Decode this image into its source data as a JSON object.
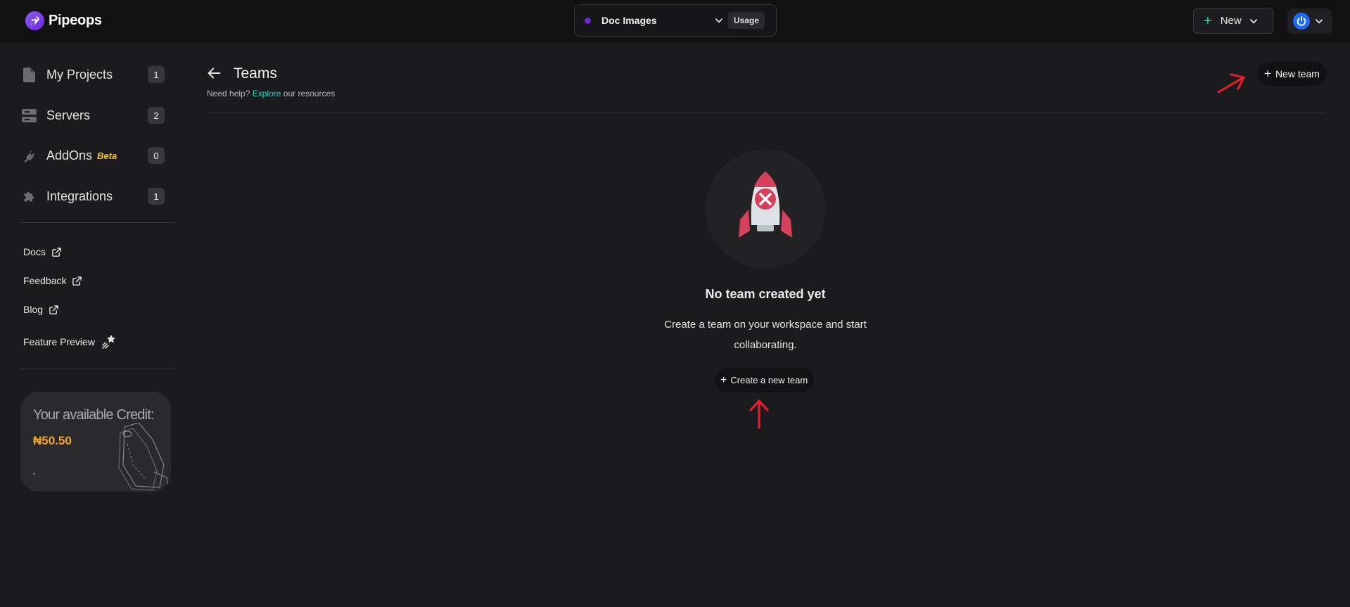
{
  "app": {
    "name": "Pipeops"
  },
  "header": {
    "workspace_name": "Doc Images",
    "usage_label": "Usage",
    "new_label": "New"
  },
  "sidebar": {
    "items": [
      {
        "label": "My Projects",
        "count": "1",
        "icon": "file-icon"
      },
      {
        "label": "Servers",
        "count": "2",
        "icon": "server-icon"
      },
      {
        "label": "AddOns",
        "badge": "Beta",
        "count": "0",
        "icon": "plug-icon"
      },
      {
        "label": "Integrations",
        "count": "1",
        "icon": "puzzle-icon"
      }
    ],
    "links": [
      {
        "label": "Docs",
        "icon": "external-link-icon"
      },
      {
        "label": "Feedback",
        "icon": "external-link-icon"
      },
      {
        "label": "Blog",
        "icon": "external-link-icon"
      },
      {
        "label": "Feature Preview",
        "icon": "sparkle-icon"
      }
    ],
    "credit": {
      "title": "Your available Credit:",
      "amount": "₦50.50"
    }
  },
  "page": {
    "title": "Teams",
    "help_prefix": "Need help?",
    "help_link": "Explore",
    "help_suffix": "our resources",
    "new_team_label": "New team"
  },
  "empty_state": {
    "title": "No team created yet",
    "description_line1": "Create a team on your workspace and start",
    "description_line2": "collaborating.",
    "button_label": "Create a new team"
  },
  "colors": {
    "background": "#1b1b1d",
    "topbar": "#111112",
    "brand": "#7c3aed",
    "accent_link": "#2dd4bf",
    "credit_amount": "#f5a623",
    "beta_badge": "#f5c518",
    "annotation_arrow": "#e11d2e"
  }
}
